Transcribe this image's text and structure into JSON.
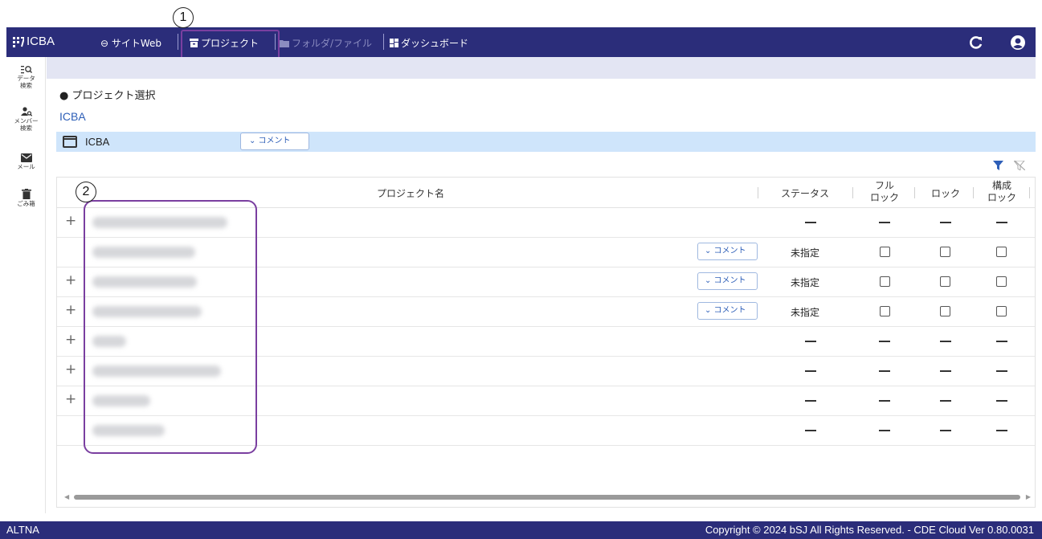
{
  "header": {
    "brand": "ICBA",
    "nav": [
      {
        "label": "サイトWeb",
        "icon": "link-icon",
        "enabled": true
      },
      {
        "label": "プロジェクト",
        "icon": "archive-icon",
        "enabled": true,
        "active": true
      },
      {
        "label": "フォルダ/ファイル",
        "icon": "folder-icon",
        "enabled": false
      },
      {
        "label": "ダッシュボード",
        "icon": "dashboard-icon",
        "enabled": true
      }
    ],
    "accent": "#2b2d7a"
  },
  "callouts": {
    "one": "1",
    "two": "2"
  },
  "sidebar": {
    "items": [
      {
        "label": "データ\n検索",
        "icon": "data-search-icon"
      },
      {
        "label": "メンバー\n検索",
        "icon": "member-search-icon"
      },
      {
        "label": "メール",
        "icon": "mail-icon"
      },
      {
        "label": "ごみ箱",
        "icon": "trash-icon"
      }
    ]
  },
  "main": {
    "section_label": "● プロジェクト選択",
    "org_link": "ICBA",
    "org_row": {
      "name": "ICBA",
      "comment_label": "⌄ コメント"
    },
    "table": {
      "headers": {
        "project_name": "プロジェクト名",
        "status": "ステータス",
        "full_lock": "フル\nロック",
        "lock": "ロック",
        "config_lock": "構成\nロック"
      },
      "rows": [
        {
          "expandable": true,
          "has_comment": false,
          "status": "",
          "type": "group"
        },
        {
          "expandable": false,
          "has_comment": true,
          "status": "未指定",
          "type": "project",
          "comment_label": "⌄ コメント"
        },
        {
          "expandable": true,
          "has_comment": true,
          "status": "未指定",
          "type": "project",
          "comment_label": "⌄ コメント"
        },
        {
          "expandable": true,
          "has_comment": true,
          "status": "未指定",
          "type": "project",
          "comment_label": "⌄ コメント"
        },
        {
          "expandable": true,
          "has_comment": false,
          "status": "",
          "type": "group"
        },
        {
          "expandable": true,
          "has_comment": false,
          "status": "",
          "type": "group"
        },
        {
          "expandable": true,
          "has_comment": false,
          "status": "",
          "type": "group"
        },
        {
          "expandable": false,
          "has_comment": false,
          "status": "",
          "type": "group"
        }
      ]
    }
  },
  "footer": {
    "left": "ALTNA",
    "right": "Copyright © 2024 bSJ All Rights Reserved. - CDE Cloud Ver 0.80.0031"
  }
}
